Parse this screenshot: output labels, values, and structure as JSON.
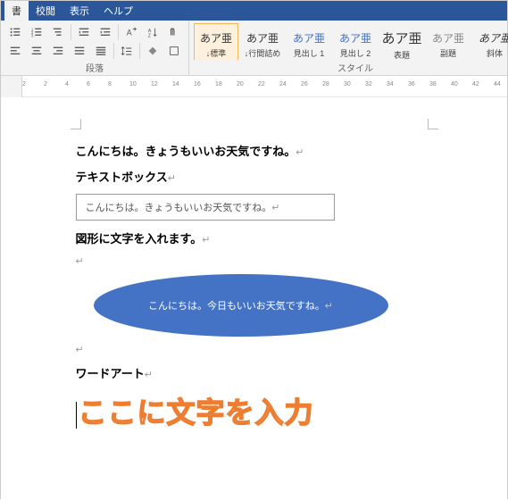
{
  "menu": {
    "tab0": "書",
    "tab1": "校閲",
    "tab2": "表示",
    "tab3": "ヘルプ"
  },
  "ribbon": {
    "group_paragraph": "段落",
    "group_styles": "スタイル",
    "styles": [
      {
        "sample": "あア亜",
        "label": "↓標準"
      },
      {
        "sample": "あア亜",
        "label": "↓行間詰め"
      },
      {
        "sample": "あア亜",
        "label": "見出し 1"
      },
      {
        "sample": "あア亜",
        "label": "見出し 2"
      },
      {
        "sample": "あア亜",
        "label": "表題"
      },
      {
        "sample": "あア亜",
        "label": "副題"
      },
      {
        "sample": "あア亜",
        "label": "斜体"
      }
    ]
  },
  "ruler": [
    "2",
    "2",
    "4",
    "6",
    "8",
    "10",
    "12",
    "14",
    "16",
    "18",
    "20",
    "22",
    "24",
    "26",
    "28",
    "30",
    "32",
    "34",
    "36",
    "38",
    "40",
    "42",
    "44"
  ],
  "doc": {
    "line1": "こんにちは。きょうもいいお天気ですね。",
    "hdr_textbox": "テキストボックス",
    "textbox_val": "こんにちは。きょうもいいお天気ですね。",
    "hdr_shape": "図形に文字を入れます。",
    "ellipse_text": "こんにちは。今日もいいお天気ですね。",
    "hdr_wordart": "ワードアート",
    "wordart_text": "ここに文字を入力"
  },
  "mark": "↵"
}
